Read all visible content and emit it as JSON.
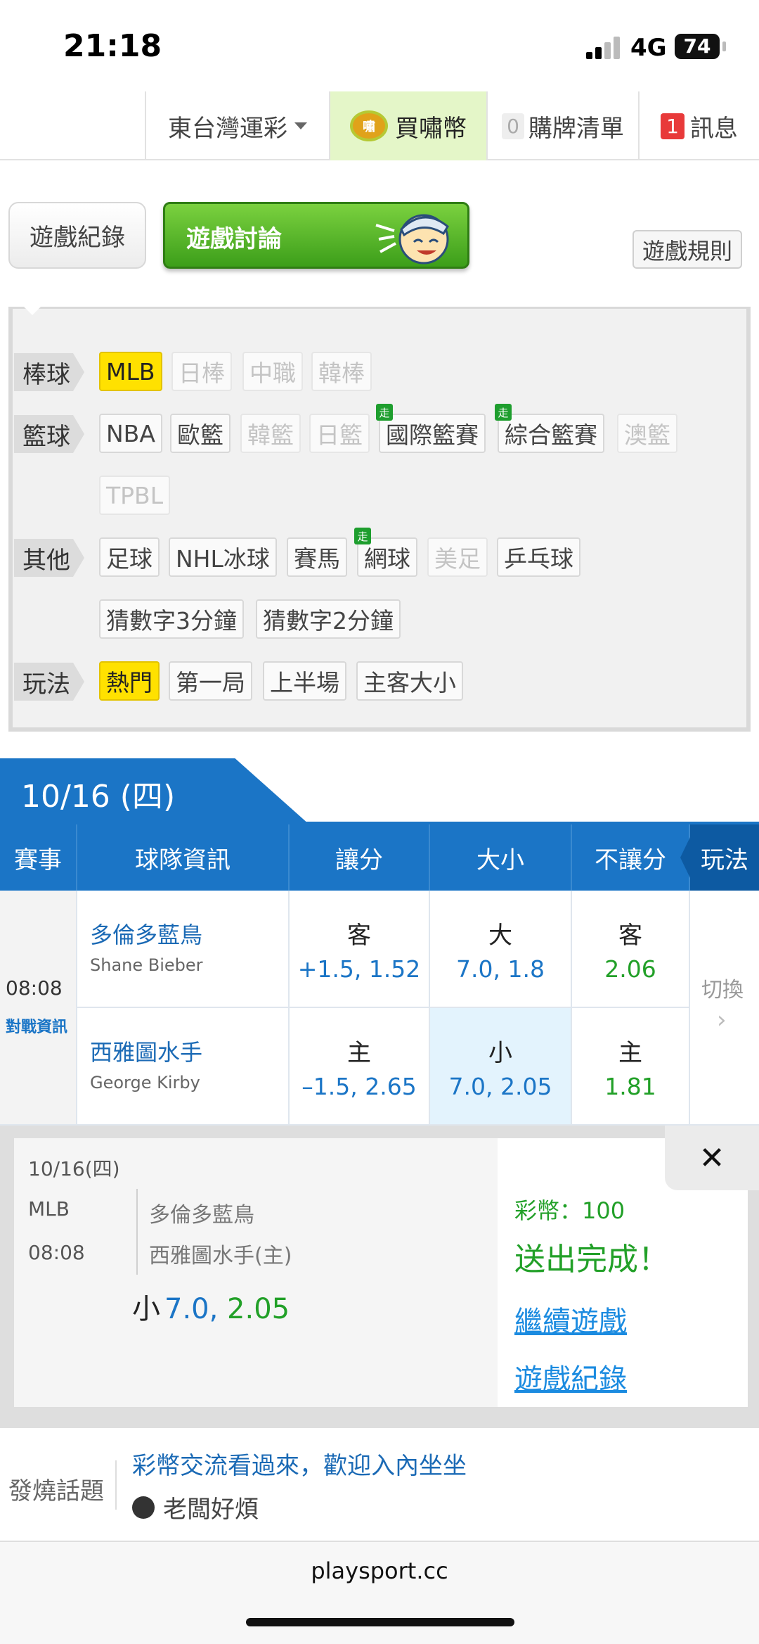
{
  "status_bar": {
    "time": "21:18",
    "network": "4G",
    "battery": "74"
  },
  "top_nav": {
    "region": "東台灣運彩",
    "buy_coins": "買嘯幣",
    "coin_badge": "嘯",
    "cart_count": "0",
    "cart_label": "購牌清單",
    "msg_count": "1",
    "msg_label": "訊息"
  },
  "actions": {
    "record": "遊戲紀錄",
    "discuss": "遊戲討論",
    "rules": "遊戲規則"
  },
  "filters": {
    "baseball": {
      "label": "棒球",
      "items": [
        "MLB",
        "日棒",
        "中職",
        "韓棒"
      ]
    },
    "basketball": {
      "label": "籃球",
      "items": [
        "NBA",
        "歐籃",
        "韓籃",
        "日籃",
        "國際籃賽",
        "綜合籃賽",
        "澳籃",
        "TPBL"
      ],
      "walk_badge": "走"
    },
    "other": {
      "label": "其他",
      "items": [
        "足球",
        "NHL冰球",
        "賽馬",
        "網球",
        "美足",
        "乒乓球",
        "猜數字3分鐘",
        "猜數字2分鐘"
      ]
    },
    "play": {
      "label": "玩法",
      "items": [
        "熱門",
        "第一局",
        "上半場",
        "主客大小"
      ]
    }
  },
  "date_tab": "10/16 (四)",
  "table": {
    "headers": [
      "賽事",
      "球隊資訊",
      "讓分",
      "大小",
      "不讓分",
      "玩法"
    ],
    "match_time": "08:08",
    "match_info_link": "對戰資訊",
    "switch_label": "切換",
    "rows": [
      {
        "team": "多倫多藍鳥",
        "pitcher": "Shane Bieber",
        "spread_side": "客",
        "spread_value": "+1.5, 1.52",
        "total_side": "大",
        "total_value": "7.0, 1.8",
        "ml_side": "客",
        "ml_value": "2.06"
      },
      {
        "team": "西雅圖水手",
        "pitcher": "George Kirby",
        "spread_side": "主",
        "spread_value": "–1.5, 2.65",
        "total_side": "小",
        "total_value": "7.0, 2.05",
        "ml_side": "主",
        "ml_value": "1.81"
      }
    ]
  },
  "ticket": {
    "date": "10/16(四)",
    "league": "MLB",
    "time": "08:08",
    "team1": "多倫多藍鳥",
    "team2": "西雅圖水手(主)",
    "pick_side": "小",
    "pick_line": "7.0,",
    "pick_odds": "2.05",
    "close": "✕",
    "coins": "彩幣：100",
    "done": "送出完成！",
    "continue": "繼續遊戲",
    "record": "遊戲紀錄"
  },
  "hot_topic": {
    "label": "發燒話題",
    "title": "彩幣交流看過來，歡迎入內坐坐",
    "user": "老闆好煩"
  },
  "url": "playsport.cc",
  "colors": {
    "primary": "#1b75c6",
    "green": "#22a028",
    "yellow": "#ffe100",
    "link": "#1b8be0"
  }
}
